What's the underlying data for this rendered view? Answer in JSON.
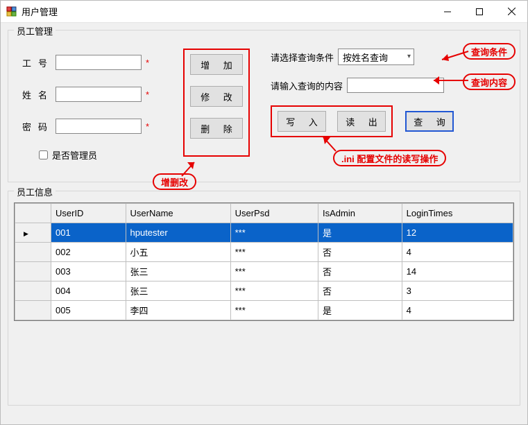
{
  "window": {
    "title": "用户管理"
  },
  "group_mgmt": {
    "title": "员工管理"
  },
  "form": {
    "id_label": "工号",
    "name_label": "姓名",
    "pwd_label": "密码",
    "required_mark": "*",
    "admin_checkbox": "是否管理员",
    "id_value": "",
    "name_value": "",
    "pwd_value": ""
  },
  "crud": {
    "add": "增  加",
    "modify": "修  改",
    "delete": "删  除"
  },
  "query": {
    "cond_label": "请选择查询条件",
    "cond_selected": "按姓名查询",
    "content_label": "请输入查询的内容",
    "content_value": "",
    "write": "写  入",
    "read": "读  出",
    "query_btn": "查  询"
  },
  "callouts": {
    "crud": "增删改",
    "cond": "查询条件",
    "content": "查询内容",
    "ini": ".ini 配置文件的读写操作"
  },
  "group_info": {
    "title": "员工信息"
  },
  "table": {
    "headers": [
      "UserID",
      "UserName",
      "UserPsd",
      "IsAdmin",
      "LoginTimes"
    ],
    "rows": [
      {
        "UserID": "001",
        "UserName": "hputester",
        "UserPsd": "***",
        "IsAdmin": "是",
        "LoginTimes": "12",
        "selected": true
      },
      {
        "UserID": "002",
        "UserName": "小五",
        "UserPsd": "***",
        "IsAdmin": "否",
        "LoginTimes": "4",
        "selected": false
      },
      {
        "UserID": "003",
        "UserName": "张三",
        "UserPsd": "***",
        "IsAdmin": "否",
        "LoginTimes": "14",
        "selected": false
      },
      {
        "UserID": "004",
        "UserName": "张三",
        "UserPsd": "***",
        "IsAdmin": "否",
        "LoginTimes": "3",
        "selected": false
      },
      {
        "UserID": "005",
        "UserName": "李四",
        "UserPsd": "***",
        "IsAdmin": "是",
        "LoginTimes": "4",
        "selected": false
      }
    ]
  }
}
